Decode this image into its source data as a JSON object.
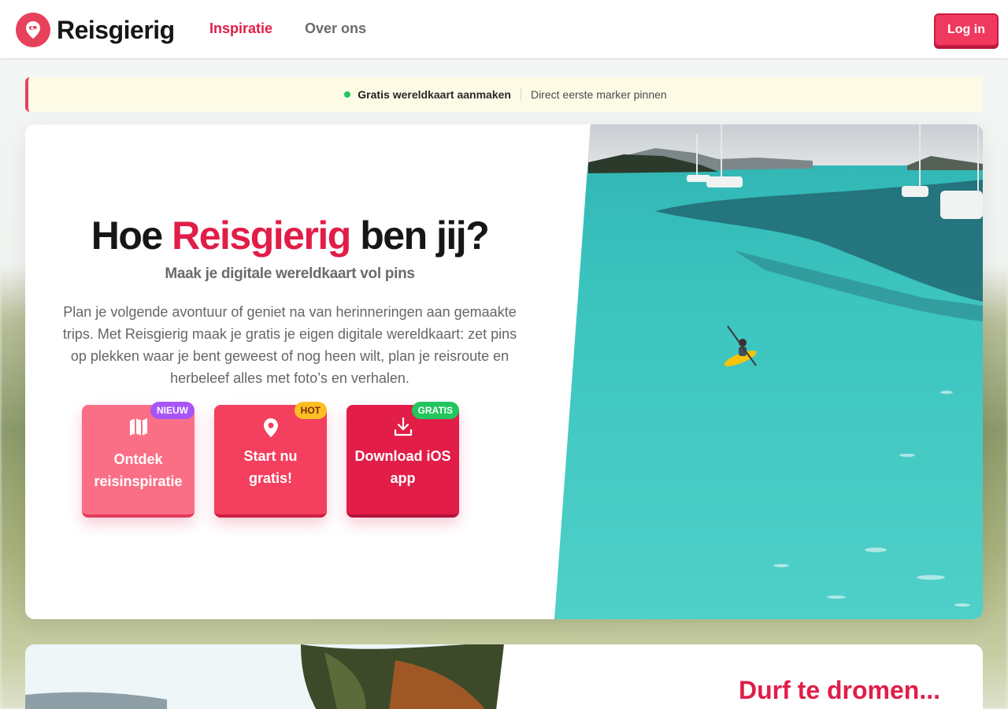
{
  "nav": {
    "brand": "Reisgierig",
    "links": [
      {
        "label": "Inspiratie",
        "active": true
      },
      {
        "label": "Over ons",
        "active": false
      }
    ],
    "login_label": "Log in"
  },
  "banner": {
    "highlight": "Gratis",
    "primary_rest": "wereldkaart aanmaken",
    "secondary": "Direct eerste marker pinnen"
  },
  "hero": {
    "title_before": "Hoe ",
    "title_accent": "Reisgierig",
    "title_after": " ben jij?",
    "subtitle": "Maak je digitale wereldkaart vol pins",
    "body": "Plan je volgende avontuur of geniet na van herinneringen aan gemaakte trips. Met Reisgierig maak je gratis je eigen digitale wereldkaart: zet pins op plekken waar je bent geweest of nog heen wilt, plan je reisroute en herbeleef alles met foto’s en verhalen.",
    "ctas": [
      {
        "label": "Ontdek reisinspiratie",
        "badge": "NIEUW",
        "icon": "map-icon"
      },
      {
        "label": "Start nu gratis!",
        "badge": "HOT",
        "icon": "map-pin-icon"
      },
      {
        "label": "Download iOS app",
        "badge": "GRATIS",
        "icon": "download-icon"
      }
    ]
  },
  "section2": {
    "title": "Durf te dromen..."
  },
  "colors": {
    "brand": "#e11d48",
    "badge_nieuw": "#a855f7",
    "badge_hot": "#fbbf24",
    "badge_gratis": "#22c55e"
  }
}
